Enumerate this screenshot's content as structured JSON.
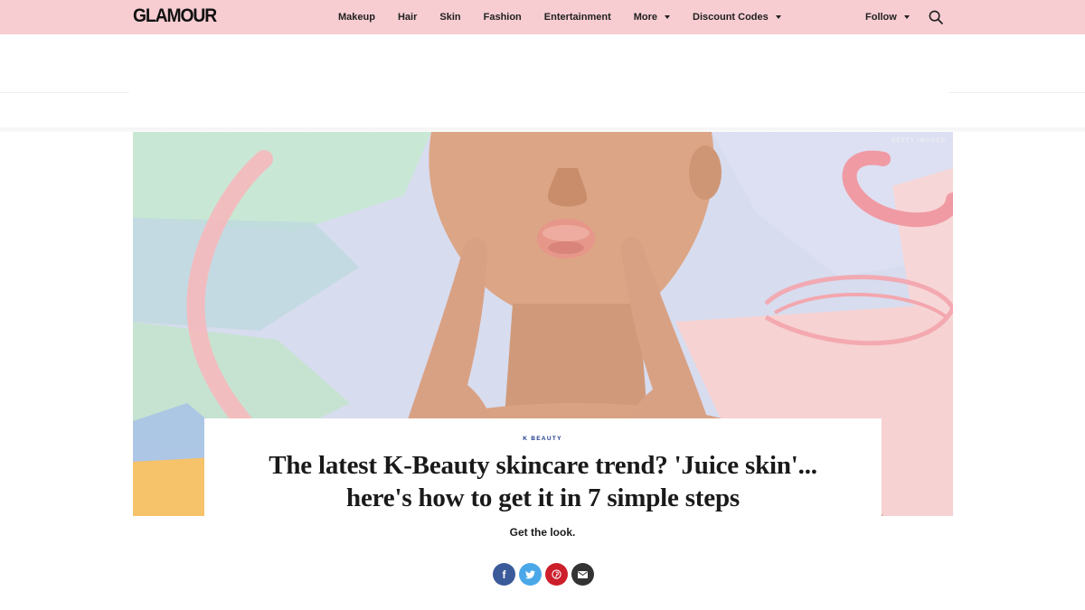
{
  "header": {
    "logo": "GLAMOUR",
    "nav": [
      {
        "label": "Makeup",
        "dropdown": false
      },
      {
        "label": "Hair",
        "dropdown": false
      },
      {
        "label": "Skin",
        "dropdown": false
      },
      {
        "label": "Fashion",
        "dropdown": false
      },
      {
        "label": "Entertainment",
        "dropdown": false
      },
      {
        "label": "More",
        "dropdown": true
      },
      {
        "label": "Discount Codes",
        "dropdown": true
      }
    ],
    "follow_label": "Follow",
    "search_icon": "search-icon"
  },
  "hero": {
    "credit": "GETTY IMAGES"
  },
  "article": {
    "kicker": "K BEAUTY",
    "headline_line1": "The latest K-Beauty skincare trend? 'Juice skin'...",
    "headline_line2": "here's how to get it in 7 simple steps",
    "dek": "Get the look."
  },
  "share": {
    "facebook": "f",
    "twitter": "twitter-icon",
    "pinterest": "pinterest-icon",
    "email": "email-icon"
  },
  "colors": {
    "nav_bg": "#f7cdd2",
    "kicker": "#1b3a8a",
    "facebook": "#3b5a9a",
    "twitter": "#4aa8e8",
    "pinterest": "#cc1f2b",
    "email": "#333333"
  }
}
